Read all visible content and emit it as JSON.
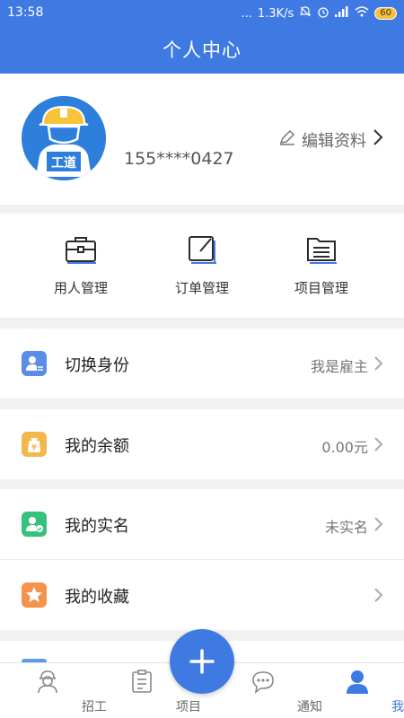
{
  "status_bar": {
    "time": "13:58",
    "dots": "...",
    "net_speed": "1.3K/s",
    "battery": "60"
  },
  "header": {
    "title": "个人中心"
  },
  "profile": {
    "avatar_text": "工道",
    "phone": "155****0427",
    "edit_label": "编辑资料"
  },
  "shortcuts": [
    {
      "label": "用人管理",
      "icon": "briefcase-icon"
    },
    {
      "label": "订单管理",
      "icon": "edit-order-icon"
    },
    {
      "label": "项目管理",
      "icon": "folder-list-icon"
    }
  ],
  "menu": [
    {
      "label": "切换身份",
      "value": "我是雇主",
      "icon": "switch-identity-icon",
      "color": "#5a8ee6"
    },
    {
      "label": "我的余额",
      "value": "0.00元",
      "icon": "wallet-icon",
      "color": "#f2b84a"
    },
    {
      "label": "我的实名",
      "value": "未实名",
      "icon": "verified-user-icon",
      "color": "#36c27c"
    },
    {
      "label": "我的收藏",
      "value": "",
      "icon": "star-icon",
      "color": "#f4934a"
    }
  ],
  "tabbar": {
    "items": [
      {
        "label": "招工",
        "icon": "worker-icon",
        "active": false
      },
      {
        "label": "项目",
        "icon": "project-icon",
        "active": false
      },
      {
        "label": "通知",
        "icon": "chat-icon",
        "active": false
      },
      {
        "label": "我的",
        "icon": "user-icon",
        "active": true
      }
    ],
    "fab_icon": "plus-icon"
  },
  "colors": {
    "primary": "#3f7ae3",
    "active_tab": "#3f7ae3",
    "inactive_tab": "#888888"
  }
}
